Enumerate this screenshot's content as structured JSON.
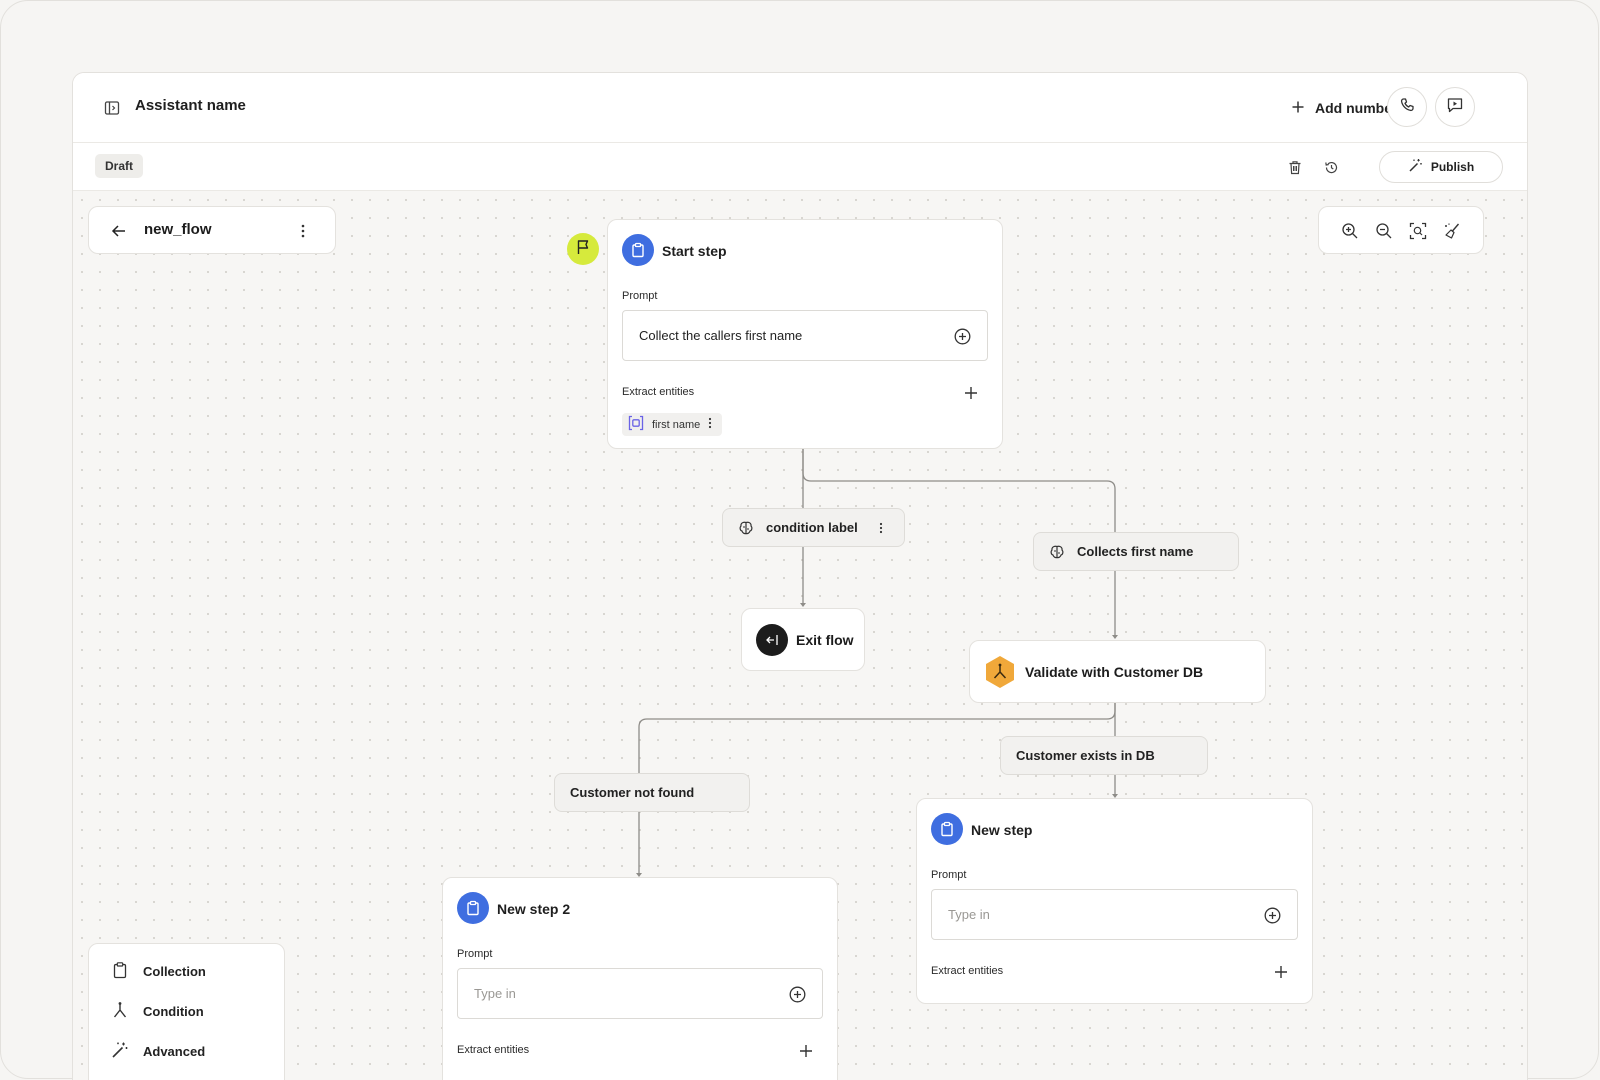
{
  "header": {
    "title": "Assistant name",
    "add_number_label": "Add number"
  },
  "subbar": {
    "status_badge": "Draft",
    "publish_label": "Publish"
  },
  "flow": {
    "name": "new_flow"
  },
  "nodes": {
    "start_step": {
      "title": "Start step",
      "prompt_label": "Prompt",
      "prompt_value": "Collect the callers first name",
      "extract_label": "Extract entities",
      "entity": "first name"
    },
    "condition_label": "condition label",
    "collects_first_name": "Collects first name",
    "exit_flow": "Exit flow",
    "validate": "Validate with Customer DB",
    "customer_exists": "Customer exists in DB",
    "customer_not_found": "Customer not found",
    "new_step": {
      "title": "New step",
      "prompt_label": "Prompt",
      "prompt_placeholder": "Type in",
      "extract_label": "Extract entities"
    },
    "new_step_2": {
      "title": "New step 2",
      "prompt_label": "Prompt",
      "prompt_placeholder": "Type in",
      "extract_label": "Extract entities"
    }
  },
  "palette": {
    "items": [
      "Collection",
      "Condition",
      "Advanced"
    ]
  },
  "colors": {
    "step_blue": "#3f6ee0",
    "start_flag": "#d6ea3c",
    "validate_orange": "#f0a83a",
    "exit_dark": "#1c1c1c"
  },
  "icons": [
    "sidebar-toggle-icon",
    "plus-icon",
    "phone-icon",
    "chat-icon",
    "trash-icon",
    "history-icon",
    "magic-wand-icon",
    "arrow-left-icon",
    "more-vertical-icon",
    "zoom-in-icon",
    "zoom-out-icon",
    "fit-view-icon",
    "tidy-icon",
    "flag-icon",
    "clipboard-icon",
    "brain-icon",
    "exit-icon",
    "branch-icon",
    "plus-circle-icon",
    "entity-icon"
  ]
}
